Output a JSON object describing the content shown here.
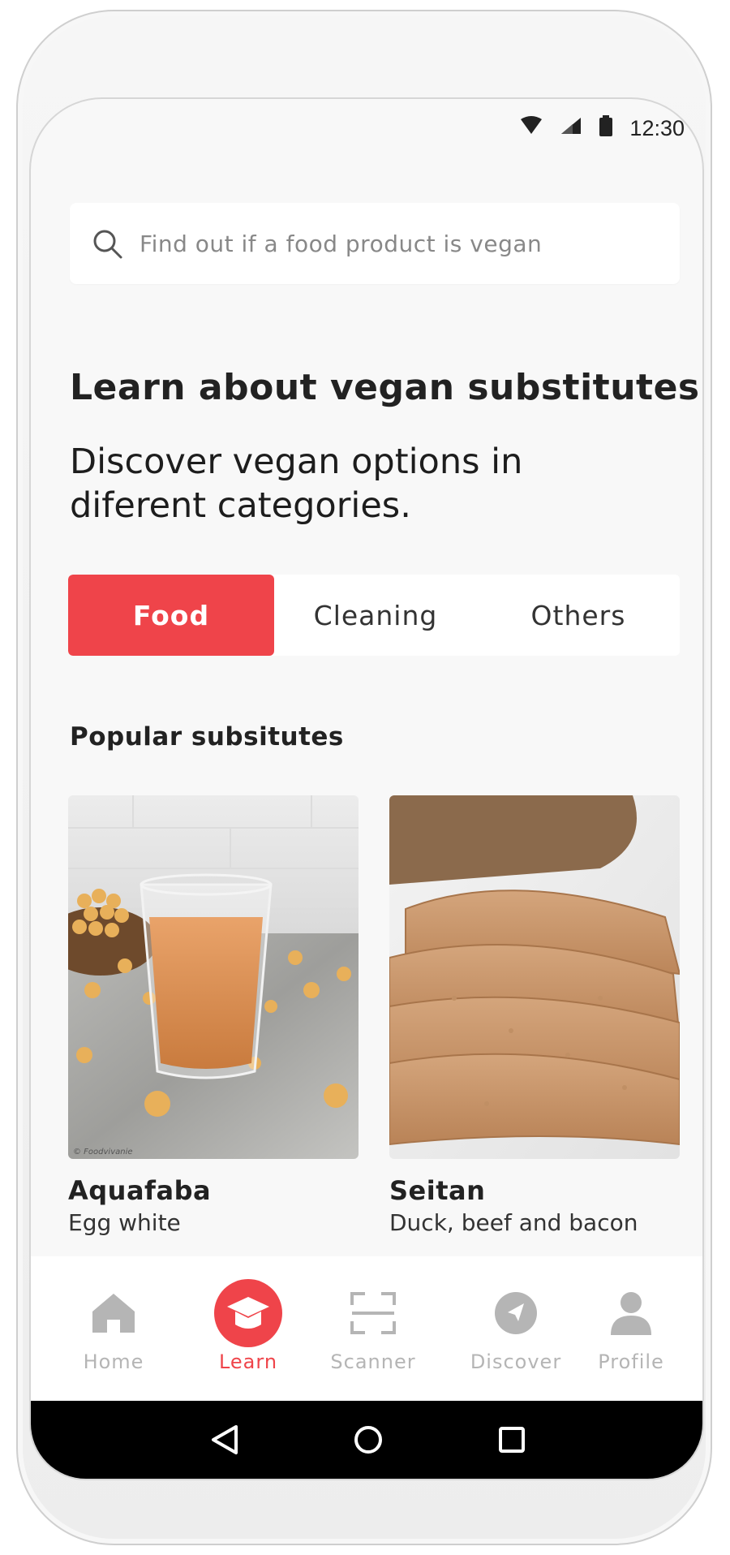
{
  "status_bar": {
    "time": "12:30"
  },
  "search": {
    "placeholder": "Find out if a food product is vegan"
  },
  "heading": "Learn about vegan substitutes",
  "subheading": "Discover vegan options in diferent categories.",
  "tabs": [
    {
      "label": "Food",
      "active": true
    },
    {
      "label": "Cleaning",
      "active": false
    },
    {
      "label": "Others",
      "active": false
    }
  ],
  "section_title": "Popular subsitutes",
  "cards": [
    {
      "name": "Aquafaba",
      "replaces": "Egg white",
      "image": "glass-of-chickpea-water-image",
      "watermark": "© Foodvivanie"
    },
    {
      "name": "Seitan",
      "replaces": "Duck, beef and bacon",
      "image": "sliced-seitan-image"
    }
  ],
  "bottom_nav": [
    {
      "label": "Home",
      "icon": "home-icon",
      "active": false
    },
    {
      "label": "Learn",
      "icon": "graduation-cap-icon",
      "active": true
    },
    {
      "label": "Scanner",
      "icon": "scanner-icon",
      "active": false
    },
    {
      "label": "Discover",
      "icon": "compass-icon",
      "active": false
    },
    {
      "label": "Profile",
      "icon": "person-icon",
      "active": false
    }
  ],
  "colors": {
    "accent": "#ef444a",
    "background": "#f8f8f8",
    "inactive": "#b5b5b5"
  }
}
